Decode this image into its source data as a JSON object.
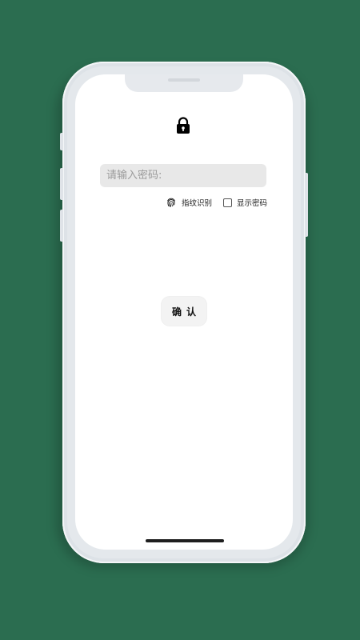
{
  "device": {
    "frame_color": "#e4e8ec",
    "background_color": "#2b6d50"
  },
  "lock": {
    "icon": "lock-icon"
  },
  "password": {
    "placeholder": "请输入密码:",
    "value": ""
  },
  "options": {
    "fingerprint_icon": "fingerprint-icon",
    "fingerprint_label": "指纹识别",
    "show_password_label": "显示密码",
    "show_password_checked": false
  },
  "confirm": {
    "label": "确认"
  }
}
